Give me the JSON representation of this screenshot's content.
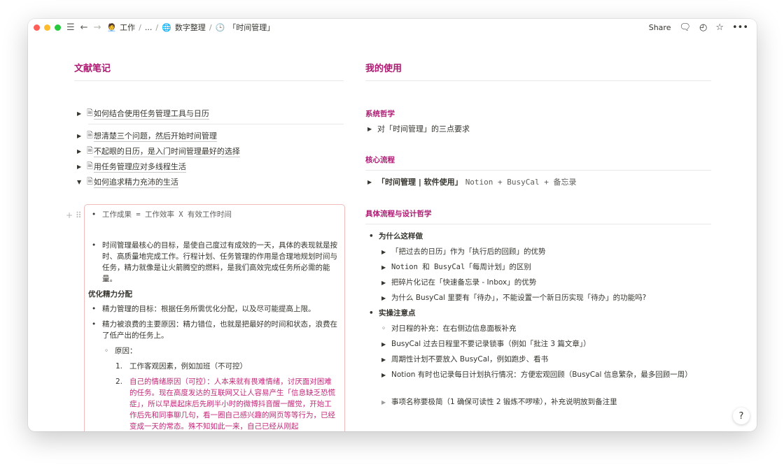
{
  "breadcrumb": {
    "items": [
      {
        "emoji": "🧑‍💼",
        "label": "工作"
      },
      {
        "emoji": "",
        "label": "..."
      },
      {
        "emoji": "🌐",
        "label": "数字整理"
      },
      {
        "emoji": "🕒",
        "label": "「时间管理」"
      }
    ]
  },
  "topbar": {
    "share_label": "Share"
  },
  "left": {
    "heading": "文献笔记",
    "toggles": [
      "如何结合使用任务管理工具与日历",
      "想清楚三个问题，然后开始时间管理",
      "不起眼的日历，是入门时间管理最好的选择",
      "用任务管理应对多线程生活",
      "如何追求精力充沛的生活"
    ],
    "callout": {
      "b1": "工作成果 = 工作效率 X 有效工作时间",
      "b2": "时间管理最核心的目标，是使自己度过有成效的一天，具体的表现就是按时、高质量地完成工作。行程计划、任务管理的作用是合理地规划时间与任务，精力就像是让火箭腾空的燃料，是我们高效完成任务所必需的能量。",
      "h1": "优化精力分配",
      "b3": "精力管理的目标：根据任务所需优化分配，以及尽可能提高上限。",
      "b4": "精力被浪费的主要原因：精力错位，也就是把最好的时间和状态，浪费在了低产出的任务上。",
      "sub1": "原因：",
      "n1": "工作客观因素，例如加班（不可控）",
      "n2": "自己的情绪原因（可控）：人本来就有畏难情绪，讨厌面对困难的任务。现在高度发达的互联网又让人容易产生「信息缺乏恐慌症」，所以早晨起床后先刷半小时的微博抖音醒一醒觉，开始工作后先和同事聊几句，看一圈自己感兴趣的网页等等行为，已经变成一天的常态。殊不知如此一来，自己已经从刚起"
    }
  },
  "right": {
    "heading": "我的使用",
    "s1": {
      "title": "系统哲学",
      "item": "对「时间管理」的三点要求"
    },
    "s2": {
      "title": "核心流程",
      "item_bold": "「时间管理 | 软件使用」",
      "item_mono": "Notion + BusyCal + 备忘录"
    },
    "s3": {
      "title": "具体流程与设计哲学",
      "why": "为什么这样做",
      "why_items": [
        "「把过去的日历」作为「执行后的回顾」的优势",
        "Notion 和 BusyCal「每周计划」的区别",
        "把碎片化记在「快速备忘录 - Inbox」的优势",
        "为什么 BusyCal 里要有「待办」，不能设置一个新日历实现「待办」的功能吗?"
      ],
      "notes": "实操注意点",
      "notes_items": [
        "对日程的补充：在右侧边信息面板补充",
        "BusyCal 过去日程里不要记录锁事（例如「批注 3 篇文章」）",
        "周期性计划不要放入 BusyCal，例如跑步、看书",
        "Notion 有时也记录每日计划执行情况：方便宏观回顾（BusyCal 信息繁杂，最多回顾一周）",
        "事项名称要极简（1 确保可读性 2 锻炼不啰嗦），补充说明放到备注里"
      ]
    }
  },
  "help_label": "?",
  "colors": {
    "accent": "#ad1a72",
    "callout_border": "#f0bcbc",
    "pink_text": "#c4287a"
  }
}
